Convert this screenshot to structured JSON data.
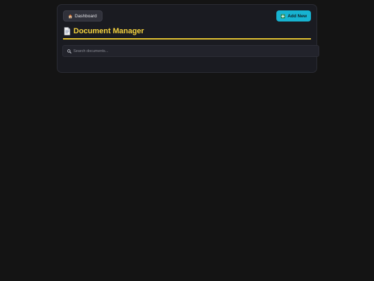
{
  "header": {
    "dashboard_label": "Dashboard",
    "dashboard_icon": "home-icon",
    "add_label": "Add New",
    "add_icon": "plus-icon",
    "add_color": "#17b3d1"
  },
  "title": {
    "text": "Document Manager",
    "icon": "document-icon",
    "color": "#f5d23e"
  },
  "search": {
    "placeholder": "Search documents...",
    "value": "",
    "icon": "search-icon"
  }
}
